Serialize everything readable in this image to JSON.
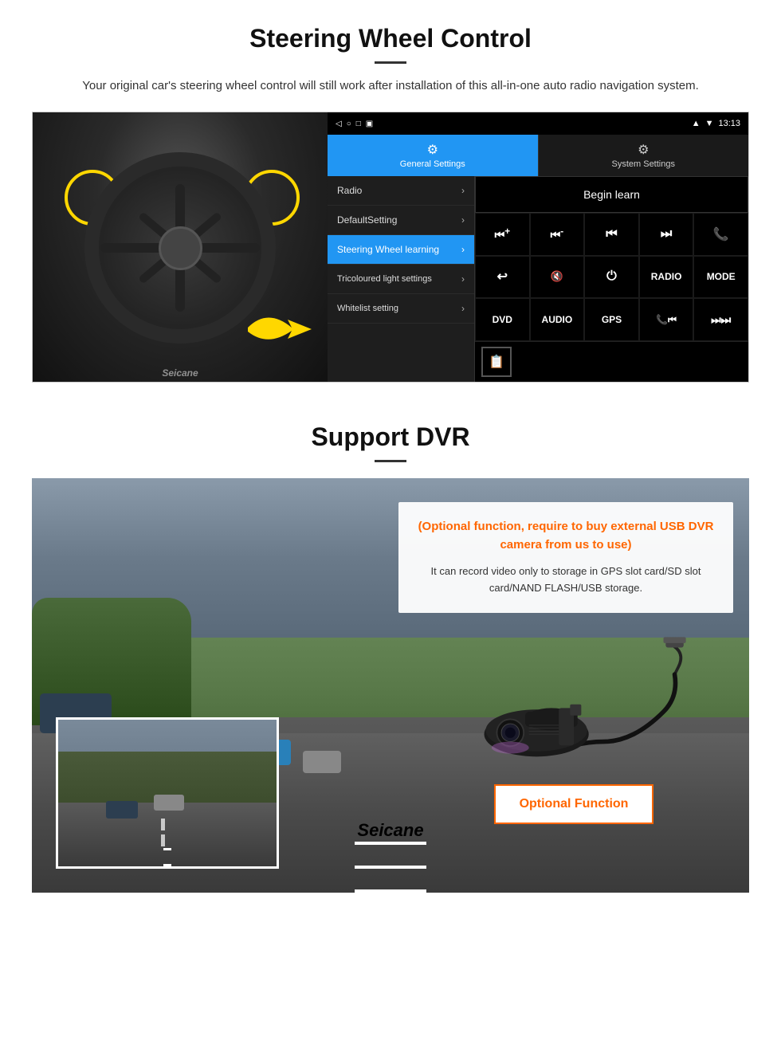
{
  "steering_section": {
    "title": "Steering Wheel Control",
    "description": "Your original car's steering wheel control will still work after installation of this all-in-one auto radio navigation system.",
    "android_ui": {
      "status_time": "13:13",
      "status_icons": "▲ ▼ ◀",
      "tab_general": "General Settings",
      "tab_system": "System Settings",
      "tab_general_icon": "⚙",
      "tab_system_icon": "🔧",
      "menu_items": [
        {
          "label": "Radio",
          "active": false
        },
        {
          "label": "DefaultSetting",
          "active": false
        },
        {
          "label": "Steering Wheel learning",
          "active": true
        },
        {
          "label": "Tricoloured light settings",
          "active": false
        },
        {
          "label": "Whitelist setting",
          "active": false
        }
      ],
      "begin_learn": "Begin learn",
      "controls": [
        "⏮+",
        "⏮-",
        "⏮",
        "⏭",
        "📞",
        "↩",
        "🔇×",
        "⏻",
        "RADIO",
        "MODE",
        "DVD",
        "AUDIO",
        "GPS",
        "📞⏮",
        "⏭⏭"
      ]
    }
  },
  "dvr_section": {
    "title": "Support DVR",
    "optional_text": "(Optional function, require to buy external USB DVR camera from us to use)",
    "description": "It can record video only to storage in GPS slot card/SD slot card/NAND FLASH/USB storage.",
    "optional_function_label": "Optional Function"
  },
  "seicane_brand": "Seicane"
}
